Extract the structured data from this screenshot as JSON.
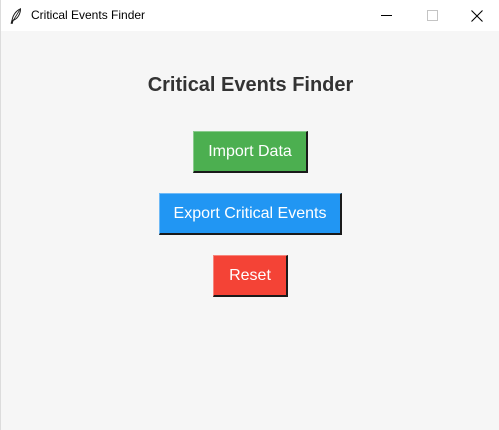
{
  "window": {
    "title": "Critical Events Finder",
    "icon": "feather-icon",
    "controls": [
      "minimize-icon",
      "maximize-icon",
      "close-icon"
    ]
  },
  "main": {
    "heading": "Critical Events Finder",
    "buttons": {
      "import_label": "Import Data",
      "export_label": "Export Critical Events",
      "reset_label": "Reset"
    }
  },
  "colors": {
    "import": "#4caf50",
    "export": "#2196f3",
    "reset": "#f44336",
    "background": "#f6f6f6",
    "heading": "#333333"
  }
}
